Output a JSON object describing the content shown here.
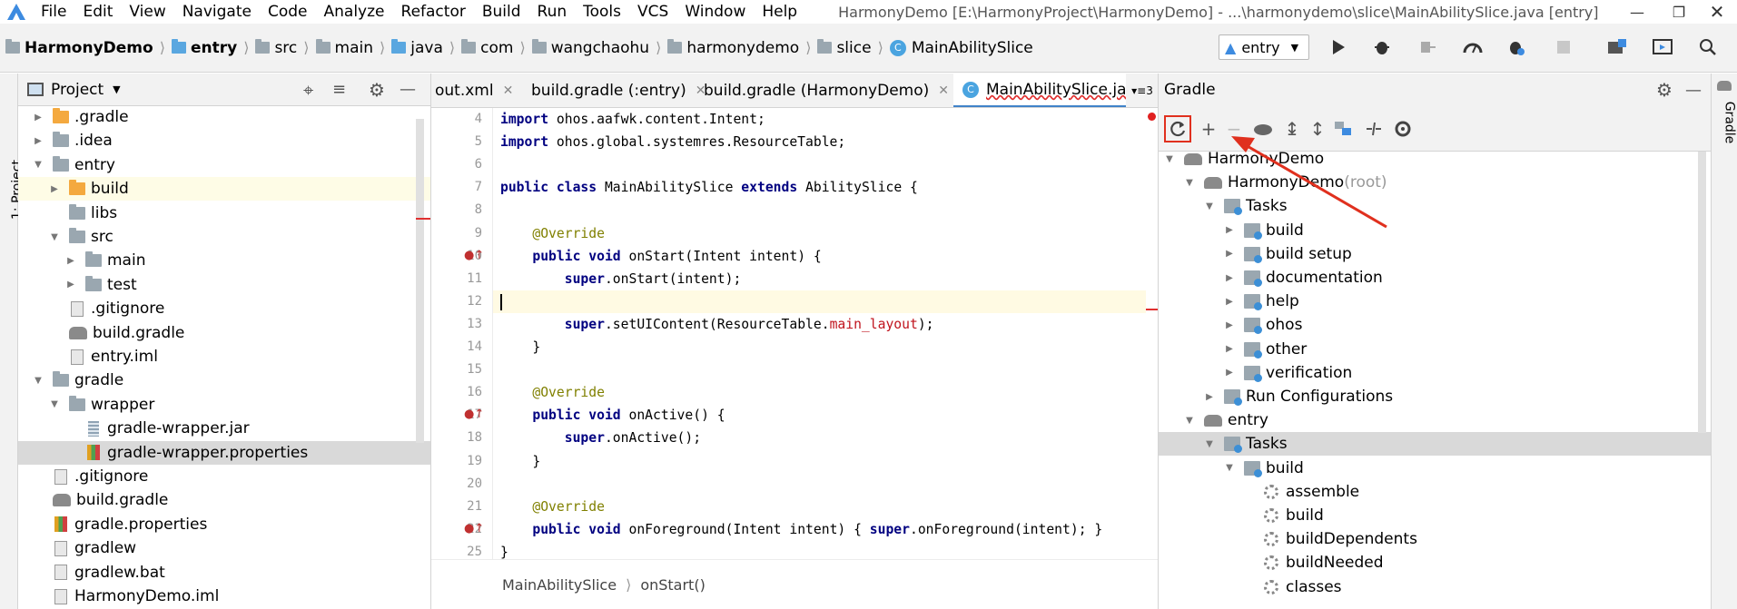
{
  "window": {
    "title": "HarmonyDemo [E:\\HarmonyProject\\HarmonyDemo] - ...\\harmonydemo\\slice\\MainAbilitySlice.java [entry]"
  },
  "menu": [
    "File",
    "Edit",
    "View",
    "Navigate",
    "Code",
    "Analyze",
    "Refactor",
    "Build",
    "Run",
    "Tools",
    "VCS",
    "Window",
    "Help"
  ],
  "breadcrumb": [
    "HarmonyDemo",
    "entry",
    "src",
    "main",
    "java",
    "com",
    "wangchaohu",
    "harmonydemo",
    "slice",
    "MainAbilitySlice"
  ],
  "run_config": "entry",
  "left_strip_label": "1: Project",
  "project_panel": {
    "title": "Project"
  },
  "project_tree": [
    {
      "label": ".gradle",
      "depth": 1,
      "icon": "folder-orange-icon",
      "arrow": "right"
    },
    {
      "label": ".idea",
      "depth": 1,
      "icon": "folder-icon",
      "arrow": "right"
    },
    {
      "label": "entry",
      "depth": 1,
      "icon": "folder-icon",
      "arrow": "down"
    },
    {
      "label": "build",
      "depth": 2,
      "icon": "folder-orange-icon",
      "arrow": "right"
    },
    {
      "label": "libs",
      "depth": 2,
      "icon": "folder-icon",
      "arrow": ""
    },
    {
      "label": "src",
      "depth": 2,
      "icon": "folder-icon",
      "arrow": "down"
    },
    {
      "label": "main",
      "depth": 3,
      "icon": "folder-icon",
      "arrow": "right"
    },
    {
      "label": "test",
      "depth": 3,
      "icon": "folder-icon",
      "arrow": "right"
    },
    {
      "label": ".gitignore",
      "depth": 2,
      "icon": "file-icon",
      "arrow": ""
    },
    {
      "label": "build.gradle",
      "depth": 2,
      "icon": "gradle-icon",
      "arrow": ""
    },
    {
      "label": "entry.iml",
      "depth": 2,
      "icon": "file-icon",
      "arrow": ""
    },
    {
      "label": "gradle",
      "depth": 1,
      "icon": "folder-icon",
      "arrow": "down"
    },
    {
      "label": "wrapper",
      "depth": 2,
      "icon": "folder-icon",
      "arrow": "down"
    },
    {
      "label": "gradle-wrapper.jar",
      "depth": 3,
      "icon": "jar-icon",
      "arrow": ""
    },
    {
      "label": "gradle-wrapper.properties",
      "depth": 3,
      "icon": "properties-icon",
      "arrow": ""
    },
    {
      "label": ".gitignore",
      "depth": 1,
      "icon": "file-icon",
      "arrow": ""
    },
    {
      "label": "build.gradle",
      "depth": 1,
      "icon": "gradle-icon",
      "arrow": ""
    },
    {
      "label": "gradle.properties",
      "depth": 1,
      "icon": "properties-icon",
      "arrow": ""
    },
    {
      "label": "gradlew",
      "depth": 1,
      "icon": "file-icon",
      "arrow": ""
    },
    {
      "label": "gradlew.bat",
      "depth": 1,
      "icon": "file-icon",
      "arrow": ""
    },
    {
      "label": "HarmonyDemo.iml",
      "depth": 1,
      "icon": "file-icon",
      "arrow": ""
    }
  ],
  "editor_tabs": [
    {
      "label": "out.xml",
      "icon": "",
      "active": false
    },
    {
      "label": "build.gradle (:entry)",
      "icon": "gradle",
      "active": false
    },
    {
      "label": "build.gradle (HarmonyDemo)",
      "icon": "gradle",
      "active": false
    },
    {
      "label": "MainAbilitySlice.java",
      "icon": "class",
      "active": true
    }
  ],
  "tabs_overflow": "3",
  "code_lines": [
    {
      "n": "4",
      "html": "<span class='kw'>import</span> ohos.aafwk.content.Intent;"
    },
    {
      "n": "5",
      "html": "<span class='kw'>import</span> ohos.global.systemres.ResourceTable;"
    },
    {
      "n": "6",
      "html": ""
    },
    {
      "n": "7",
      "html": "<span class='kw'>public class</span> MainAbilitySlice <span class='kw'>extends</span> AbilitySlice {"
    },
    {
      "n": "8",
      "html": ""
    },
    {
      "n": "9",
      "html": "    <span class='an'>@Override</span>"
    },
    {
      "n": "10",
      "html": "    <span class='kw'>public void</span> onStart(Intent intent) {"
    },
    {
      "n": "11",
      "html": "        <span class='kw'>super</span>.onStart(intent);"
    },
    {
      "n": "12",
      "html": "",
      "cur": true
    },
    {
      "n": "13",
      "html": "        <span class='kw'>super</span>.setUIContent(ResourceTable.<span class='fd'>main_layout</span>);"
    },
    {
      "n": "14",
      "html": "    }"
    },
    {
      "n": "15",
      "html": ""
    },
    {
      "n": "16",
      "html": "    <span class='an'>@Override</span>"
    },
    {
      "n": "17",
      "html": "    <span class='kw'>public void</span> onActive() {"
    },
    {
      "n": "18",
      "html": "        <span class='kw'>super</span>.onActive();"
    },
    {
      "n": "19",
      "html": "    }"
    },
    {
      "n": "20",
      "html": ""
    },
    {
      "n": "21",
      "html": "    <span class='an'>@Override</span>"
    },
    {
      "n": "22",
      "html": "    <span class='kw'>public void</span> onForeground(Intent intent) { <span class='kw'>super</span>.onForeground(intent); }"
    },
    {
      "n": "25",
      "html": "}"
    }
  ],
  "editor_breadcrumb": [
    "MainAbilitySlice",
    "onStart()"
  ],
  "gradle_panel": {
    "title": "Gradle",
    "right_strip_label": "Gradle"
  },
  "gradle_tree": [
    {
      "label": "HarmonyDemo",
      "suffix": "",
      "depth": 0,
      "icon": "elephant",
      "arrow": "down"
    },
    {
      "label": "HarmonyDemo",
      "suffix": " (root)",
      "depth": 1,
      "icon": "elephant",
      "arrow": "down"
    },
    {
      "label": "Tasks",
      "suffix": "",
      "depth": 2,
      "icon": "tasks",
      "arrow": "down"
    },
    {
      "label": "build",
      "suffix": "",
      "depth": 3,
      "icon": "tasks",
      "arrow": "right"
    },
    {
      "label": "build setup",
      "suffix": "",
      "depth": 3,
      "icon": "tasks",
      "arrow": "right"
    },
    {
      "label": "documentation",
      "suffix": "",
      "depth": 3,
      "icon": "tasks",
      "arrow": "right"
    },
    {
      "label": "help",
      "suffix": "",
      "depth": 3,
      "icon": "tasks",
      "arrow": "right"
    },
    {
      "label": "ohos",
      "suffix": "",
      "depth": 3,
      "icon": "tasks",
      "arrow": "right"
    },
    {
      "label": "other",
      "suffix": "",
      "depth": 3,
      "icon": "tasks",
      "arrow": "right"
    },
    {
      "label": "verification",
      "suffix": "",
      "depth": 3,
      "icon": "tasks",
      "arrow": "right"
    },
    {
      "label": "Run Configurations",
      "suffix": "",
      "depth": 2,
      "icon": "tasks",
      "arrow": "right"
    },
    {
      "label": "entry",
      "suffix": "",
      "depth": 1,
      "icon": "elephant",
      "arrow": "down"
    },
    {
      "label": "Tasks",
      "suffix": "",
      "depth": 2,
      "icon": "tasks",
      "arrow": "down",
      "selected": true
    },
    {
      "label": "build",
      "suffix": "",
      "depth": 3,
      "icon": "tasks",
      "arrow": "down"
    },
    {
      "label": "assemble",
      "suffix": "",
      "depth": 4,
      "icon": "gear",
      "arrow": ""
    },
    {
      "label": "build",
      "suffix": "",
      "depth": 4,
      "icon": "gear",
      "arrow": ""
    },
    {
      "label": "buildDependents",
      "suffix": "",
      "depth": 4,
      "icon": "gear",
      "arrow": ""
    },
    {
      "label": "buildNeeded",
      "suffix": "",
      "depth": 4,
      "icon": "gear",
      "arrow": ""
    },
    {
      "label": "classes",
      "suffix": "",
      "depth": 4,
      "icon": "gear",
      "arrow": ""
    }
  ],
  "colors": {
    "accent": "#4083c9",
    "highlight_box": "#e0301e",
    "annotation_arrow": "#e0301e",
    "selection": "#d9d9d9",
    "current_line": "#fffae3"
  }
}
